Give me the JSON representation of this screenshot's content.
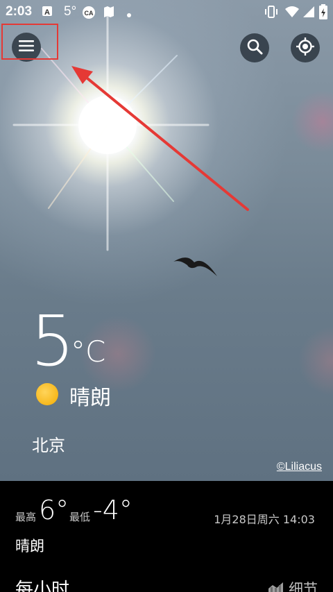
{
  "status_bar": {
    "time": "2:03",
    "temperature": "5°",
    "icons": [
      "notification-a-icon",
      "ca-icon",
      "map-icon",
      "dot-icon",
      "vibrate-icon",
      "wifi-icon",
      "signal-icon",
      "battery-icon"
    ]
  },
  "toolbar": {
    "menu_icon": "hamburger-menu-icon",
    "search_icon": "search-icon",
    "locate_icon": "gps-locate-icon"
  },
  "annotation": {
    "highlight_color": "#e53935",
    "arrow_color": "#e53935"
  },
  "current": {
    "temperature": "5",
    "unit": "°C",
    "condition_icon": "sunny-icon",
    "condition": "晴朗",
    "city": "北京"
  },
  "photo_credit": "©Liliacus",
  "today": {
    "high_label": "最高",
    "high_value": "6°",
    "low_label": "最低",
    "low_value": "-4°",
    "updated": "1月28日周六 14:03",
    "condition": "晴朗"
  },
  "hourly": {
    "title": "每小时",
    "details_icon": "chart-icon",
    "details_label": "细节"
  }
}
